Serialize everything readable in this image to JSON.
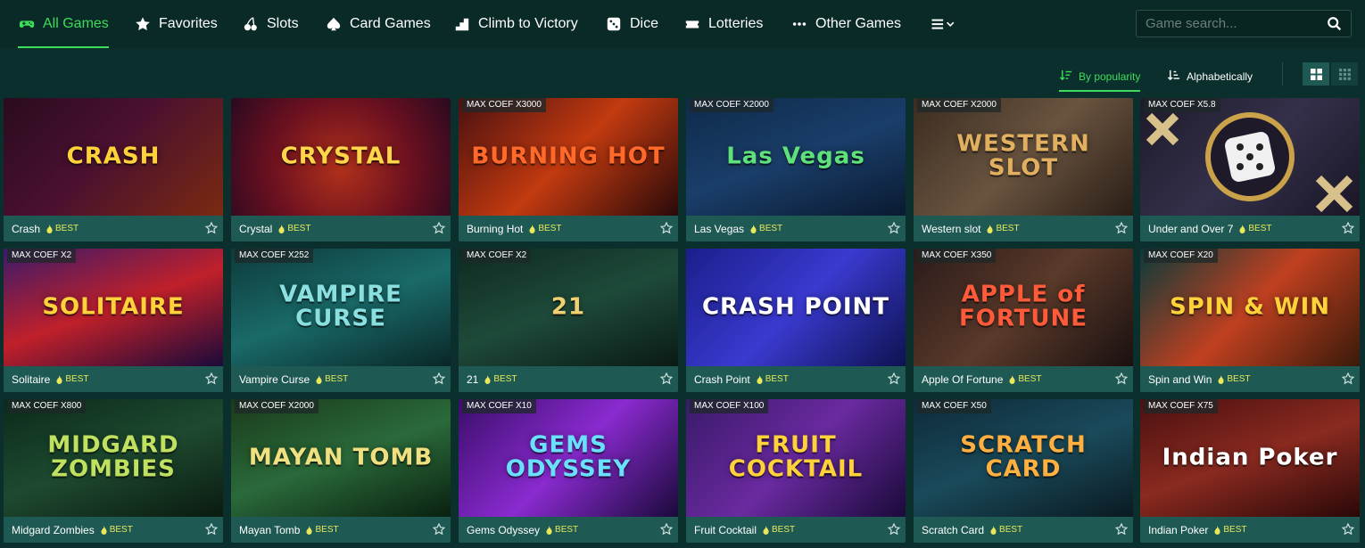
{
  "nav": {
    "items": [
      {
        "label": "All Games",
        "icon": "gamepad-icon",
        "active": true
      },
      {
        "label": "Favorites",
        "icon": "star-icon"
      },
      {
        "label": "Slots",
        "icon": "cherries-icon"
      },
      {
        "label": "Card Games",
        "icon": "spade-icon"
      },
      {
        "label": "Climb to Victory",
        "icon": "stairs-icon"
      },
      {
        "label": "Dice",
        "icon": "dice-icon"
      },
      {
        "label": "Lotteries",
        "icon": "ticket-icon"
      },
      {
        "label": "Other Games",
        "icon": "dots-icon"
      }
    ],
    "more_icon": "menu-chevron-icon"
  },
  "search": {
    "placeholder": "Game search..."
  },
  "sort": {
    "popularity": "By popularity",
    "alphabetical": "Alphabetically"
  },
  "badge_label": "BEST",
  "colors": {
    "accent": "#3ddc5a",
    "badge": "#e8e85a",
    "card": "#1e5a53",
    "background": "#0b2f2c"
  },
  "games": [
    {
      "name": "Crash",
      "coef": "",
      "art": "CRASH"
    },
    {
      "name": "Crystal",
      "coef": "",
      "art": "CRYSTAL"
    },
    {
      "name": "Burning Hot",
      "coef": "MAX COEF X3000",
      "art": "BURNING HOT"
    },
    {
      "name": "Las Vegas",
      "coef": "MAX COEF X2000",
      "art": "Las Vegas"
    },
    {
      "name": "Western slot",
      "coef": "MAX COEF X2000",
      "art": "WESTERN SLOT"
    },
    {
      "name": "Under and Over 7",
      "coef": "MAX COEF X5.8",
      "art": ""
    },
    {
      "name": "Solitaire",
      "coef": "MAX COEF X2",
      "art": "SOLITAIRE"
    },
    {
      "name": "Vampire Curse",
      "coef": "MAX COEF X252",
      "art": "VAMPIRE CURSE"
    },
    {
      "name": "21",
      "coef": "MAX COEF X2",
      "art": "21"
    },
    {
      "name": "Crash Point",
      "coef": "",
      "art": "CRASH POINT"
    },
    {
      "name": "Apple Of Fortune",
      "coef": "MAX COEF X350",
      "art": "APPLE of FORTUNE"
    },
    {
      "name": "Spin and Win",
      "coef": "MAX COEF X20",
      "art": "SPIN & WIN"
    },
    {
      "name": "Midgard Zombies",
      "coef": "MAX COEF X800",
      "art": "MIDGARD ZOMBIES"
    },
    {
      "name": "Mayan Tomb",
      "coef": "MAX COEF X2000",
      "art": "MAYAN TOMB"
    },
    {
      "name": "Gems Odyssey",
      "coef": "MAX COEF X10",
      "art": "GEMS ODYSSEY"
    },
    {
      "name": "Fruit Cocktail",
      "coef": "MAX COEF X100",
      "art": "FRUIT COCKTAIL"
    },
    {
      "name": "Scratch Card",
      "coef": "MAX COEF X50",
      "art": "SCRATCH CARD"
    },
    {
      "name": "Indian Poker",
      "coef": "MAX COEF X75",
      "art": "Indian Poker"
    }
  ]
}
